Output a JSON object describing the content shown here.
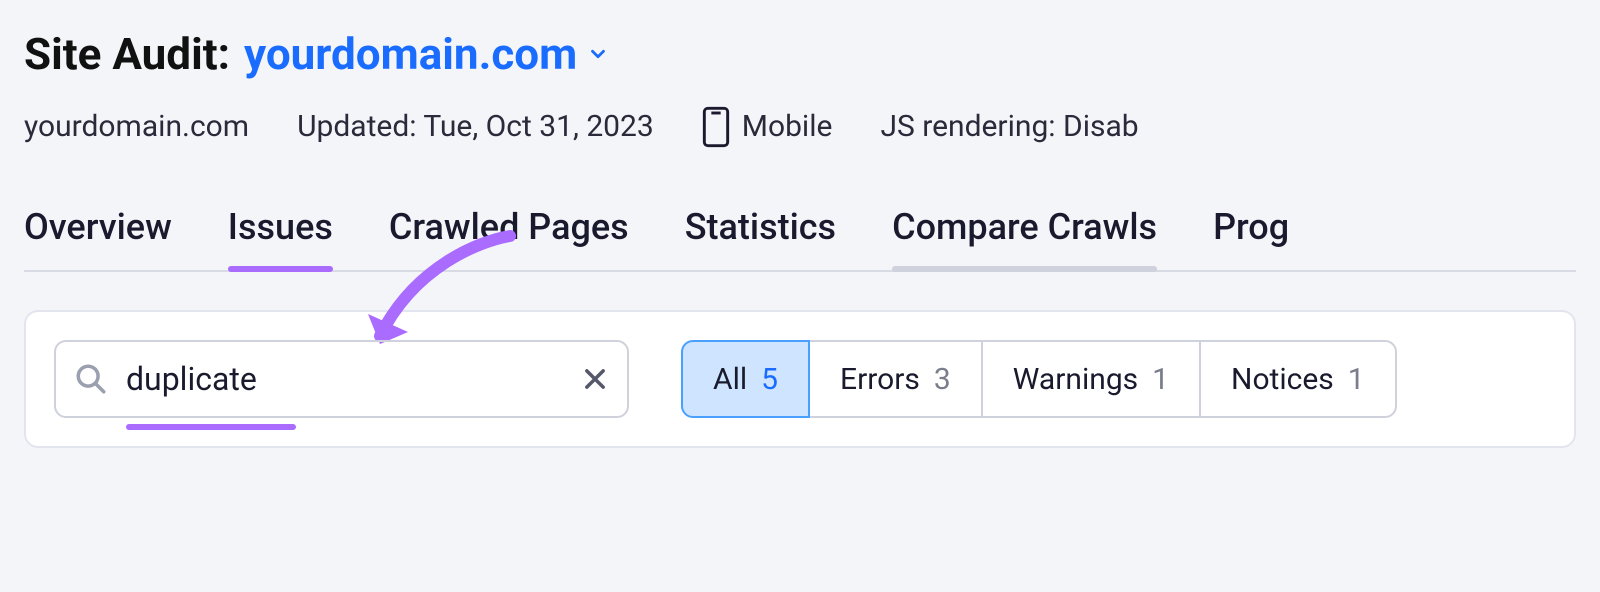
{
  "header": {
    "title_prefix": "Site Audit:",
    "domain": "yourdomain.com"
  },
  "meta": {
    "domain": "yourdomain.com",
    "updated": "Updated: Tue, Oct 31, 2023",
    "device": "Mobile",
    "js_rendering": "JS rendering: Disab"
  },
  "tabs": {
    "overview": "Overview",
    "issues": "Issues",
    "crawled_pages": "Crawled Pages",
    "statistics": "Statistics",
    "compare_crawls": "Compare Crawls",
    "progress": "Prog"
  },
  "search": {
    "value": "duplicate"
  },
  "filters": {
    "all": {
      "label": "All",
      "count": "5"
    },
    "errors": {
      "label": "Errors",
      "count": "3"
    },
    "warnings": {
      "label": "Warnings",
      "count": "1"
    },
    "notices": {
      "label": "Notices",
      "count": "1"
    }
  },
  "colors": {
    "accent_blue": "#1a6cff",
    "accent_purple": "#a96cff",
    "filter_active_bg": "#cfe5ff"
  }
}
